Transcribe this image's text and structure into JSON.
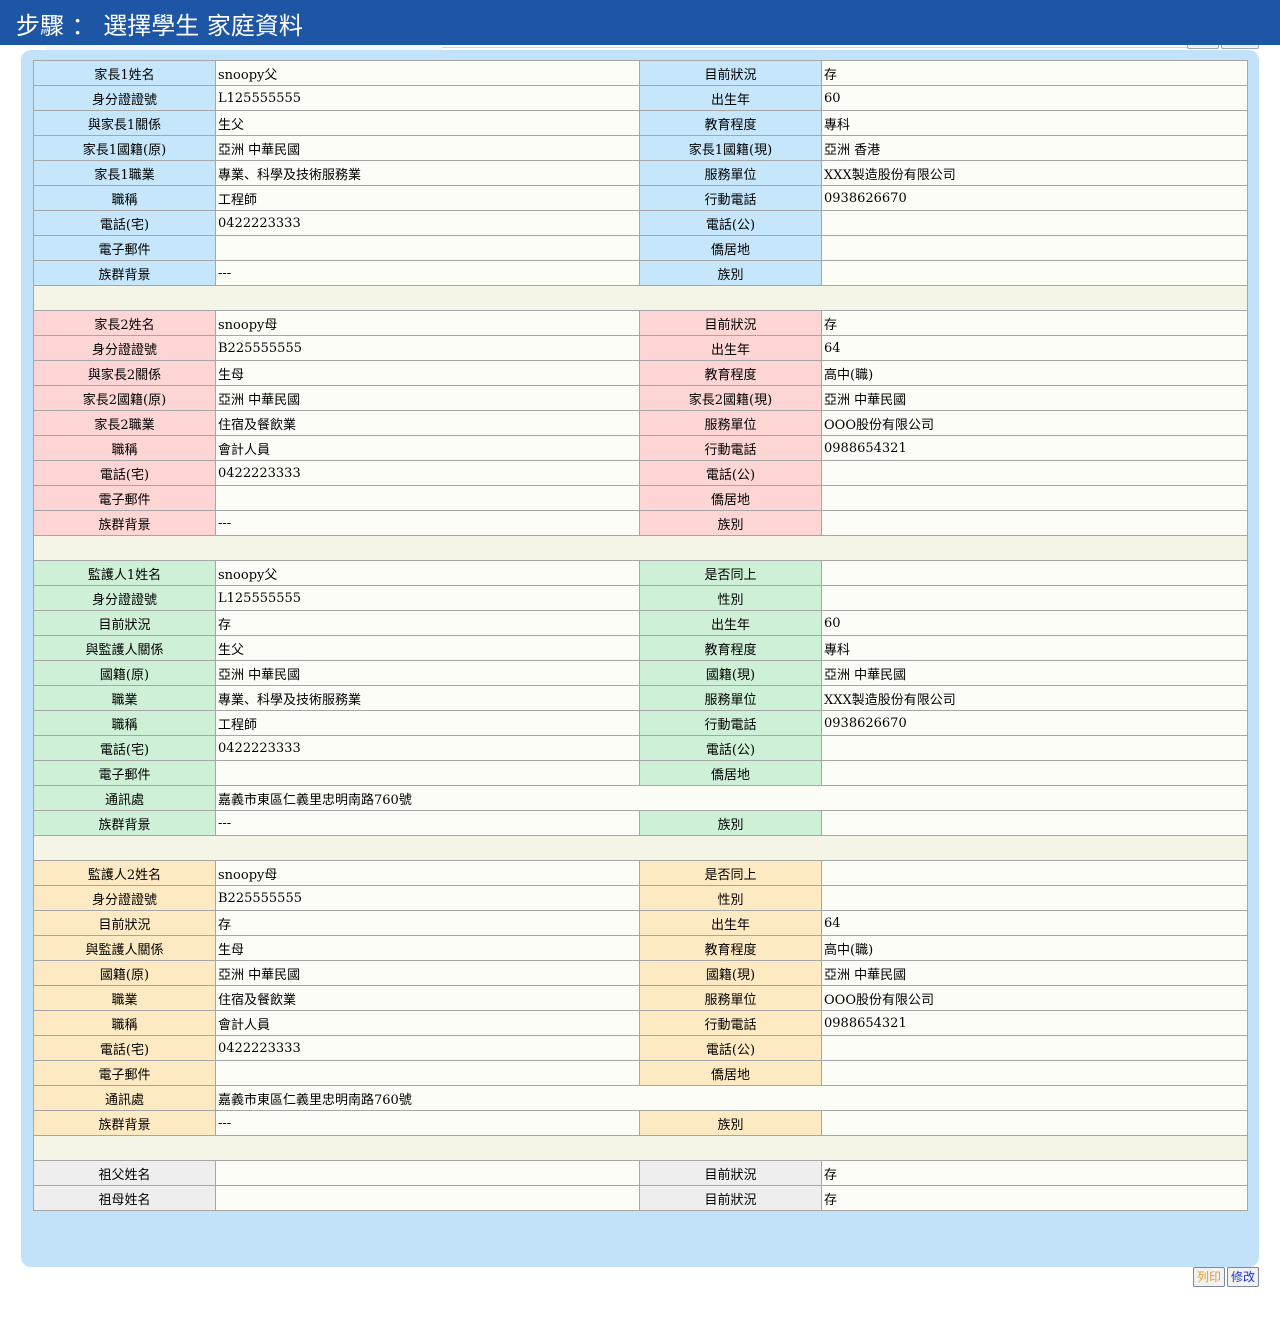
{
  "header": {
    "title": "步驟 ： 選擇學生  家庭資料"
  },
  "colors": {
    "header_bg": "#1e56a6",
    "panel_bg": "#c2e2f9",
    "parent1": "#c6e6fb",
    "parent2": "#fdd5d5",
    "guardian1": "#cef0d6",
    "guardian2": "#feeac2",
    "grandparents": "#eeeeee"
  },
  "parent1": {
    "name_label": "家長1姓名",
    "name": "snoopy父",
    "status_label": "目前狀況",
    "status": "存",
    "id_label": "身分證證號",
    "id": "L125555555",
    "birth_label": "出生年",
    "birth": "60",
    "rel_label": "與家長1關係",
    "rel": "生父",
    "edu_label": "教育程度",
    "edu": "專科",
    "nat_orig_label": "家長1國籍(原)",
    "nat_orig": "亞洲 中華民國",
    "nat_now_label": "家長1國籍(現)",
    "nat_now": "亞洲 香港",
    "occ_label": "家長1職業",
    "occ": "專業、科學及技術服務業",
    "employer_label": "服務單位",
    "employer": "XXX製造股份有限公司",
    "title_label": "職稱",
    "title": "工程師",
    "mobile_label": "行動電話",
    "mobile": "0938626670",
    "tel_home_label": "電話(宅)",
    "tel_home": "0422223333",
    "tel_office_label": "電話(公)",
    "tel_office": "",
    "email_label": "電子郵件",
    "email": "",
    "residence_label": "僑居地",
    "residence": "",
    "ethnic_label": "族群背景",
    "ethnic": "---",
    "tribe_label": "族別",
    "tribe": ""
  },
  "parent2": {
    "name_label": "家長2姓名",
    "name": "snoopy母",
    "status_label": "目前狀況",
    "status": "存",
    "id_label": "身分證證號",
    "id": "B225555555",
    "birth_label": "出生年",
    "birth": "64",
    "rel_label": "與家長2關係",
    "rel": "生母",
    "edu_label": "教育程度",
    "edu": "高中(職)",
    "nat_orig_label": "家長2國籍(原)",
    "nat_orig": "亞洲 中華民國",
    "nat_now_label": "家長2國籍(現)",
    "nat_now": "亞洲 中華民國",
    "occ_label": "家長2職業",
    "occ": "住宿及餐飲業",
    "employer_label": "服務單位",
    "employer": "OOO股份有限公司",
    "title_label": "職稱",
    "title": "會計人員",
    "mobile_label": "行動電話",
    "mobile": "0988654321",
    "tel_home_label": "電話(宅)",
    "tel_home": "0422223333",
    "tel_office_label": "電話(公)",
    "tel_office": "",
    "email_label": "電子郵件",
    "email": "",
    "residence_label": "僑居地",
    "residence": "",
    "ethnic_label": "族群背景",
    "ethnic": "---",
    "tribe_label": "族別",
    "tribe": ""
  },
  "guardian1": {
    "name_label": "監護人1姓名",
    "name": "snoopy父",
    "same_label": "是否同上",
    "same": "",
    "id_label": "身分證證號",
    "id": "L125555555",
    "gender_label": "性別",
    "gender": "",
    "status_label": "目前狀況",
    "status": "存",
    "birth_label": "出生年",
    "birth": "60",
    "rel_label": "與監護人關係",
    "rel": "生父",
    "edu_label": "教育程度",
    "edu": "專科",
    "nat_orig_label": "國籍(原)",
    "nat_orig": "亞洲 中華民國",
    "nat_now_label": "國籍(現)",
    "nat_now": "亞洲 中華民國",
    "occ_label": "職業",
    "occ": "專業、科學及技術服務業",
    "employer_label": "服務單位",
    "employer": "XXX製造股份有限公司",
    "title_label": "職稱",
    "title": "工程師",
    "mobile_label": "行動電話",
    "mobile": "0938626670",
    "tel_home_label": "電話(宅)",
    "tel_home": "0422223333",
    "tel_office_label": "電話(公)",
    "tel_office": "",
    "email_label": "電子郵件",
    "email": "",
    "residence_label": "僑居地",
    "residence": "",
    "address_label": "通訊處",
    "address": "嘉義市東區仁義里忠明南路760號",
    "ethnic_label": "族群背景",
    "ethnic": "---",
    "tribe_label": "族別",
    "tribe": ""
  },
  "guardian2": {
    "name_label": "監護人2姓名",
    "name": "snoopy母",
    "same_label": "是否同上",
    "same": "",
    "id_label": "身分證證號",
    "id": "B225555555",
    "gender_label": "性別",
    "gender": "",
    "status_label": "目前狀況",
    "status": "存",
    "birth_label": "出生年",
    "birth": "64",
    "rel_label": "與監護人關係",
    "rel": "生母",
    "edu_label": "教育程度",
    "edu": "高中(職)",
    "nat_orig_label": "國籍(原)",
    "nat_orig": "亞洲 中華民國",
    "nat_now_label": "國籍(現)",
    "nat_now": "亞洲 中華民國",
    "occ_label": "職業",
    "occ": "住宿及餐飲業",
    "employer_label": "服務單位",
    "employer": "OOO股份有限公司",
    "title_label": "職稱",
    "title": "會計人員",
    "mobile_label": "行動電話",
    "mobile": "0988654321",
    "tel_home_label": "電話(宅)",
    "tel_home": "0422223333",
    "tel_office_label": "電話(公)",
    "tel_office": "",
    "email_label": "電子郵件",
    "email": "",
    "residence_label": "僑居地",
    "residence": "",
    "address_label": "通訊處",
    "address": "嘉義市東區仁義里忠明南路760號",
    "ethnic_label": "族群背景",
    "ethnic": "---",
    "tribe_label": "族別",
    "tribe": ""
  },
  "grandparents": {
    "gf_label": "祖父姓名",
    "gf_name": "",
    "gf_status_label": "目前狀況",
    "gf_status": "存",
    "gm_label": "祖母姓名",
    "gm_name": "",
    "gm_status_label": "目前狀況",
    "gm_status": "存"
  },
  "buttons": {
    "print": "列印",
    "edit": "修改"
  }
}
